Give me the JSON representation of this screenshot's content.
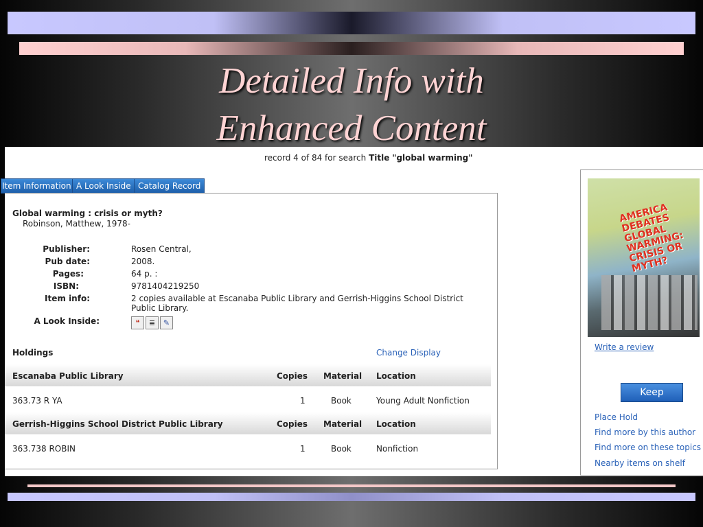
{
  "slide": {
    "title_line1": "Detailed Info with",
    "title_line2": "Enhanced Content"
  },
  "record": {
    "prefix": "record 4 of 84 for search",
    "field": "Title",
    "query": "\"global warming\""
  },
  "tabs": [
    {
      "label": "Item Information"
    },
    {
      "label": "A Look Inside"
    },
    {
      "label": "Catalog Record"
    }
  ],
  "item": {
    "title": "Global warming : crisis or myth?",
    "author": "Robinson, Matthew, 1978-",
    "fields": {
      "publisher_label": "Publisher:",
      "publisher": "Rosen Central,",
      "pubdate_label": "Pub date:",
      "pubdate": "2008.",
      "pages_label": "Pages:",
      "pages": "64 p. :",
      "isbn_label": "ISBN:",
      "isbn": "9781404219250",
      "iteminfo_label": "Item info:",
      "iteminfo": "2 copies available at Escanaba Public Library and Gerrish-Higgins School District Public Library.",
      "lookinside_label": "A Look Inside:"
    },
    "look_icons": [
      "author-notes-icon",
      "summary-icon",
      "reviews-icon"
    ]
  },
  "holdings": {
    "title": "Holdings",
    "change_display": "Change Display",
    "headers": {
      "copies": "Copies",
      "material": "Material",
      "location": "Location"
    },
    "libraries": [
      {
        "name": "Escanaba Public Library",
        "call": "363.73 R YA",
        "copies": "1",
        "material": "Book",
        "location": "Young Adult Nonfiction"
      },
      {
        "name": "Gerrish-Higgins School District Public Library",
        "call": "363.738 ROBIN",
        "copies": "1",
        "material": "Book",
        "location": "Nonfiction"
      }
    ]
  },
  "sidebar": {
    "cover_title": "AMERICA DEBATES GLOBAL WARMING: CRISIS OR MYTH?",
    "write_review": "Write a review",
    "keep": "Keep",
    "links": [
      "Place Hold",
      "Find more by this author",
      "Find more on these topics",
      "Nearby items on shelf"
    ]
  },
  "colors": {
    "link": "#2a62b8",
    "tab": "#1e5faa",
    "title": "#ffd4d4"
  }
}
